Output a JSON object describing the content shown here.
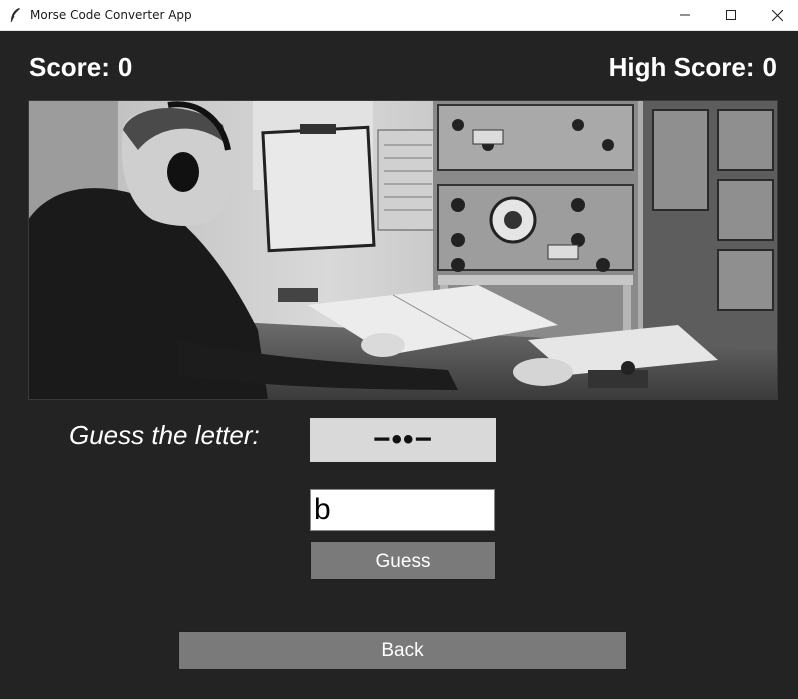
{
  "window": {
    "title": "Morse Code Converter App",
    "app_icon": "feather-icon",
    "controls": [
      "minimize-icon",
      "maximize-icon",
      "close-icon"
    ]
  },
  "scores": {
    "score_label": "Score:",
    "score_value": "0",
    "high_score_label": "High Score:",
    "high_score_value": "0"
  },
  "image": {
    "subject": "telegraph-operator-photo"
  },
  "quiz": {
    "prompt": "Guess the letter:",
    "morse": "−••−",
    "input_value": "b",
    "guess_label": "Guess"
  },
  "nav": {
    "back_label": "Back"
  },
  "colors": {
    "background": "#232323",
    "button": "#7a7a7a",
    "morse_box": "#d9d9d9"
  }
}
